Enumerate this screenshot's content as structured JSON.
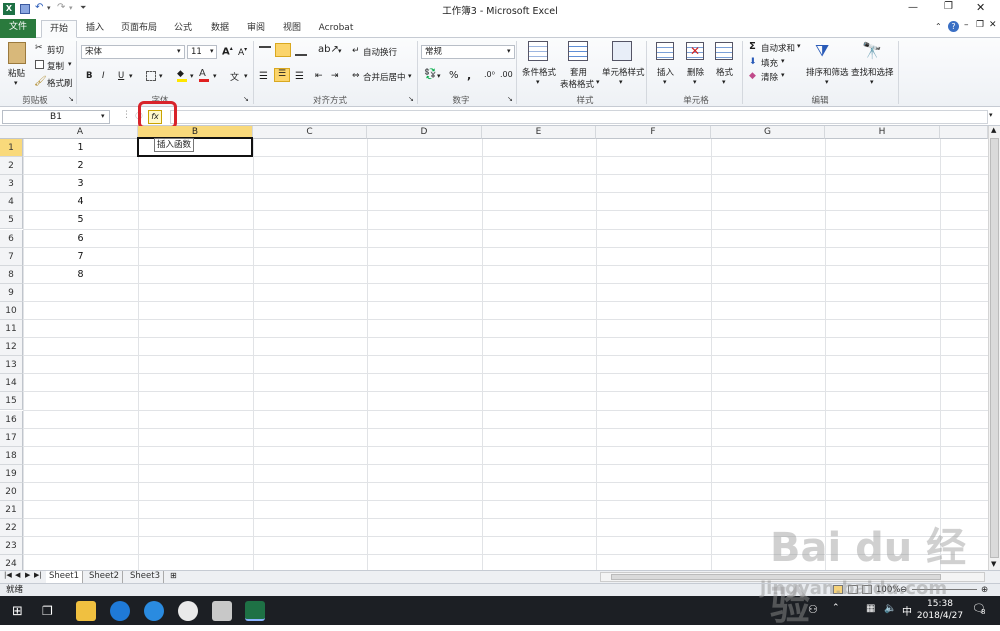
{
  "window": {
    "title": "工作簿3 - Microsoft Excel"
  },
  "tabs": [
    "文件",
    "开始",
    "插入",
    "页面布局",
    "公式",
    "数据",
    "审阅",
    "视图",
    "Acrobat"
  ],
  "ribbon": {
    "clipboard": {
      "paste": "粘贴",
      "cut": "剪切",
      "copy": "复制",
      "format_painter": "格式刷",
      "label": "剪贴板"
    },
    "font": {
      "name": "宋体",
      "size": "11",
      "bold": "B",
      "italic": "I",
      "underline": "U",
      "label": "字体"
    },
    "alignment": {
      "wrap": "自动换行",
      "merge": "合并后居中",
      "label": "对齐方式"
    },
    "number": {
      "format": "常规",
      "percent": "%",
      "comma": ",",
      "label": "数字"
    },
    "styles": {
      "conditional": "条件格式",
      "table_line1": "套用",
      "table_line2": "表格格式",
      "cell_styles": "单元格样式",
      "label": "样式"
    },
    "cells": {
      "insert": "插入",
      "delete": "删除",
      "format": "格式",
      "label": "单元格"
    },
    "editing": {
      "autosum": "自动求和",
      "fill": "填充",
      "clear": "清除",
      "sort": "排序和筛选",
      "find": "查找和选择",
      "label": "编辑"
    }
  },
  "formula_bar": {
    "name_box": "B1",
    "fx_label": "fx",
    "tooltip": "插入函数"
  },
  "columns": [
    "A",
    "B",
    "C",
    "D",
    "E",
    "F",
    "G",
    "H"
  ],
  "rows": [
    "1",
    "2",
    "3",
    "4",
    "5",
    "6",
    "7",
    "8",
    "9",
    "10",
    "11",
    "12",
    "13",
    "14",
    "15",
    "16",
    "17",
    "18",
    "19",
    "20",
    "21",
    "22",
    "23",
    "24"
  ],
  "column_a_values": [
    "1",
    "2",
    "3",
    "4",
    "5",
    "6",
    "7",
    "8"
  ],
  "sheets": [
    "Sheet1",
    "Sheet2",
    "Sheet3"
  ],
  "status": {
    "ready": "就绪",
    "zoom": "100%"
  },
  "taskbar": {
    "time": "15:38",
    "date": "2018/4/27",
    "ime": "中",
    "notifications": "8"
  },
  "watermark": {
    "main": "Bai du 经验",
    "sub": "jingyan.baidu.com"
  },
  "colors": {
    "file_tab": "#2a7a3d",
    "selected_header": "#f9d97b",
    "highlight_ring": "#d8232a"
  }
}
